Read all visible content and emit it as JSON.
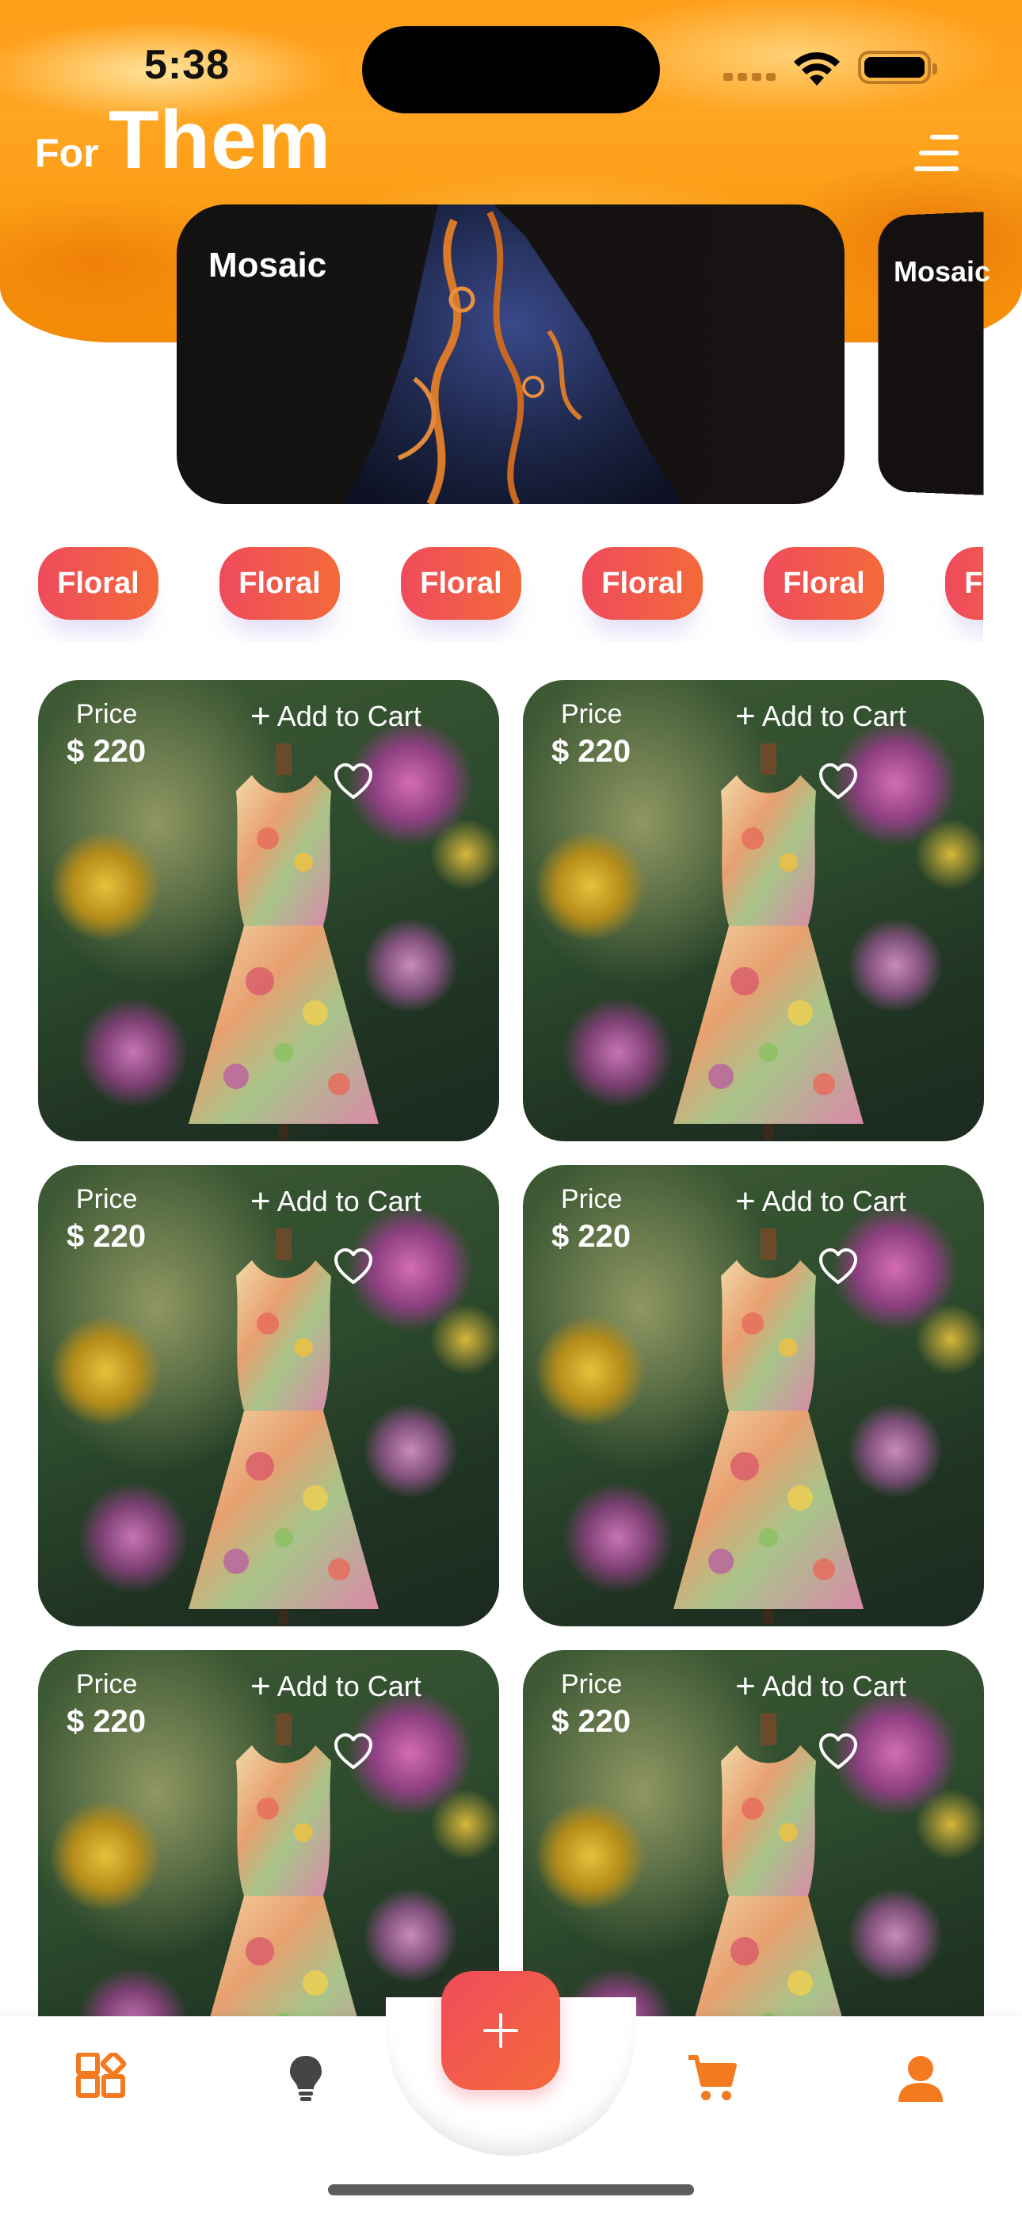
{
  "status_bar": {
    "time": "5:38"
  },
  "header": {
    "title_prefix": "For",
    "title_main": "Them"
  },
  "featured": {
    "items": [
      {
        "label": "Mosaic"
      },
      {
        "label": "Mosaic"
      }
    ]
  },
  "categories": [
    "Floral",
    "Floral",
    "Floral",
    "Floral",
    "Floral",
    "Floral"
  ],
  "products": [
    {
      "price_label": "Price",
      "price": "$ 220",
      "add_to_cart": "Add to Cart"
    },
    {
      "price_label": "Price",
      "price": "$ 220",
      "add_to_cart": "Add to Cart"
    },
    {
      "price_label": "Price",
      "price": "$ 220",
      "add_to_cart": "Add to Cart"
    },
    {
      "price_label": "Price",
      "price": "$ 220",
      "add_to_cart": "Add to Cart"
    },
    {
      "price_label": "Price",
      "price": "$ 220",
      "add_to_cart": "Add to Cart"
    },
    {
      "price_label": "Price",
      "price": "$ 220",
      "add_to_cart": "Add to Cart"
    }
  ],
  "tab_bar": {
    "tabs": [
      {
        "icon": "categories-icon",
        "active": true
      },
      {
        "icon": "lightbulb-icon",
        "active": false
      },
      {
        "icon": "cart-icon",
        "active": true
      },
      {
        "icon": "profile-icon",
        "active": true
      }
    ],
    "fab_icon": "plus-icon"
  },
  "colors": {
    "accent_orange": "#f47a1f",
    "chip_gradient_start": "#ef4b5c",
    "chip_gradient_end": "#f46a3a",
    "header_orange": "#ffa521"
  }
}
